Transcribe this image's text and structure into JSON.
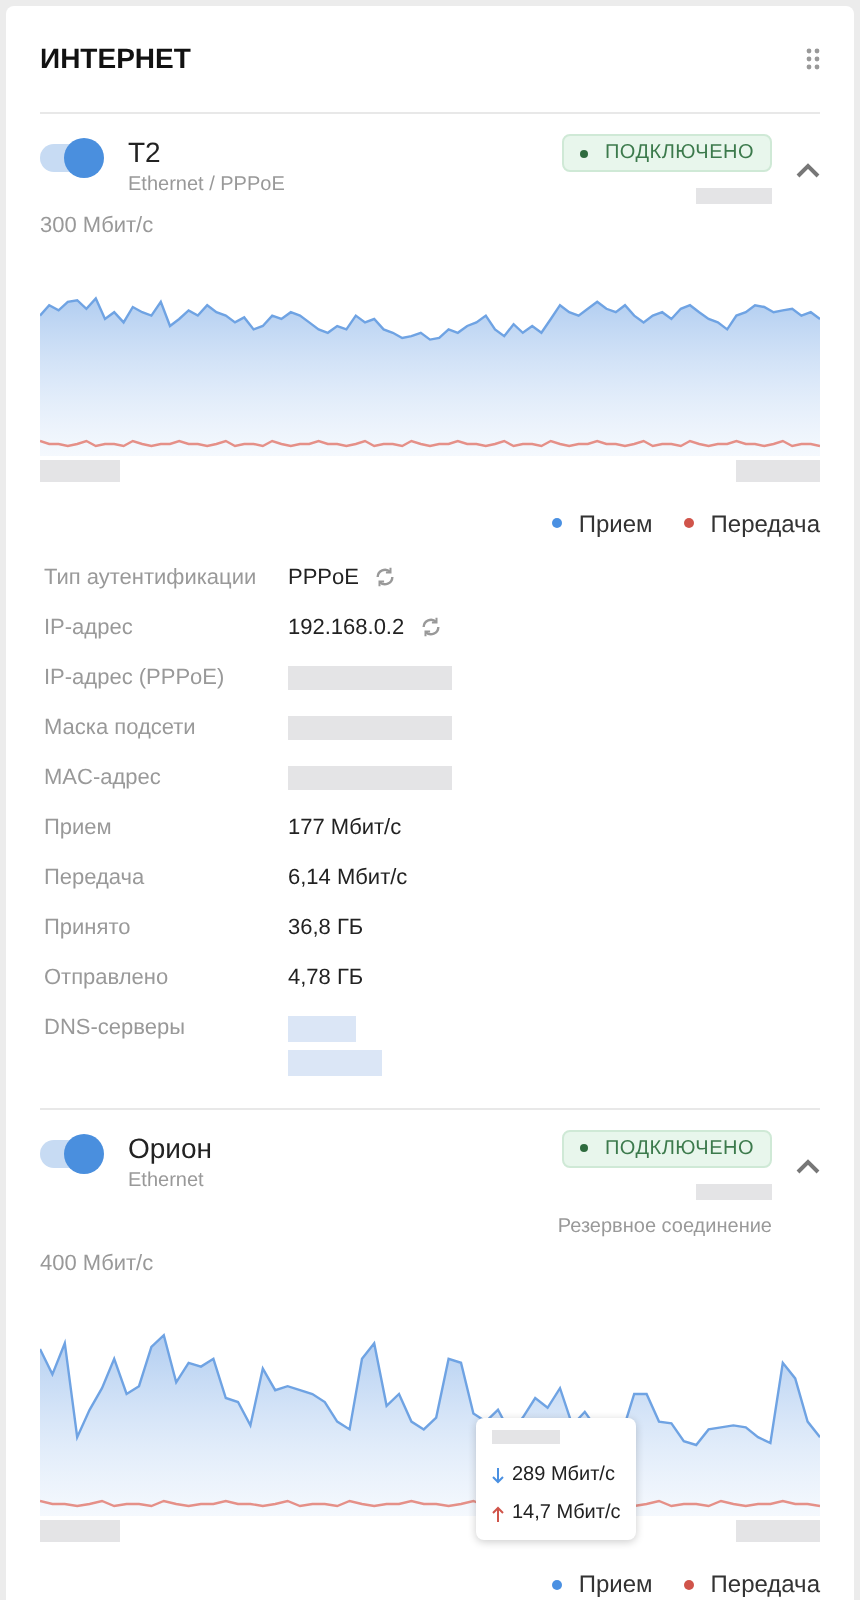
{
  "widget": {
    "title": "ИНТЕРНЕТ"
  },
  "connections": [
    {
      "name": "T2",
      "type": "Ethernet / PPPoE",
      "enabled": true,
      "expanded": true,
      "status": "ПОДКЛЮЧЕНО",
      "scale_label": "300 Мбит/с",
      "legend": [
        {
          "label": "Прием",
          "color": "#4a90e2"
        },
        {
          "label": "Передача",
          "color": "#d0544a"
        }
      ],
      "details": [
        {
          "label": "Тип аутентификации",
          "value": "PPPoE",
          "kind": "refresh"
        },
        {
          "label": "IP-адрес",
          "value": "192.168.0.2",
          "kind": "refresh"
        },
        {
          "label": "IP-адрес (PPPoE)",
          "kind": "redacted"
        },
        {
          "label": "Маска подсети",
          "kind": "redacted"
        },
        {
          "label": "MAC-адрес",
          "kind": "redacted"
        },
        {
          "label": "Прием",
          "value": "177 Мбит/с",
          "kind": "text"
        },
        {
          "label": "Передача",
          "value": "6,14 Мбит/с",
          "kind": "text"
        },
        {
          "label": "Принято",
          "value": "36,8 ГБ",
          "kind": "text"
        },
        {
          "label": "Отправлено",
          "value": "4,78 ГБ",
          "kind": "text"
        },
        {
          "label": "DNS-серверы",
          "kind": "redacted-list"
        }
      ]
    },
    {
      "name": "Орион",
      "type": "Ethernet",
      "enabled": true,
      "expanded": true,
      "status": "ПОДКЛЮЧЕНО",
      "note": "Резервное соединение",
      "scale_label": "400 Мбит/с",
      "tooltip": {
        "down": "289 Мбит/с",
        "up": "14,7 Мбит/с"
      },
      "legend": [
        {
          "label": "Прием",
          "color": "#4a90e2"
        },
        {
          "label": "Передача",
          "color": "#d0544a"
        }
      ]
    }
  ]
}
